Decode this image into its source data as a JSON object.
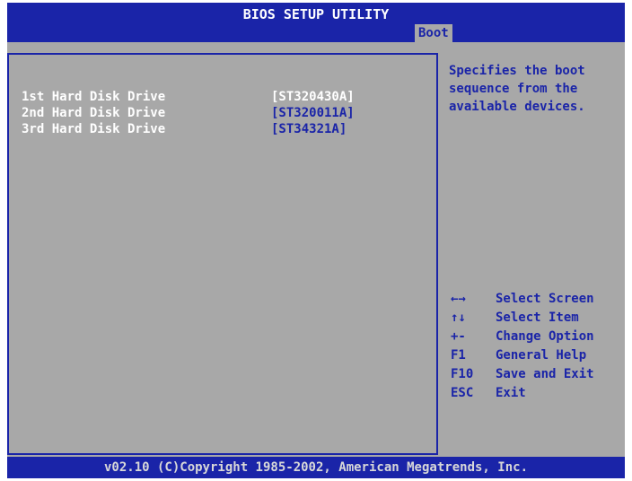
{
  "window": {
    "title": "BIOS SETUP UTILITY"
  },
  "tabs": [
    {
      "label": "Boot"
    }
  ],
  "main": {
    "items": [
      {
        "label": "1st Hard Disk Drive",
        "value": "[ST320430A]"
      },
      {
        "label": "2nd Hard Disk Drive",
        "value": "[ST320011A]"
      },
      {
        "label": "3rd Hard Disk Drive",
        "value": "[ST34321A]"
      }
    ]
  },
  "help": {
    "text": "Specifies the boot sequence from the available devices.",
    "keys": [
      {
        "key": "←→",
        "desc": "Select Screen",
        "icon": "left-right-arrows-icon"
      },
      {
        "key": "↑↓",
        "desc": "Select Item",
        "icon": "up-down-arrows-icon"
      },
      {
        "key": "+-",
        "desc": "Change Option",
        "icon": "plus-minus-icon"
      },
      {
        "key": "F1",
        "desc": "General Help"
      },
      {
        "key": "F10",
        "desc": "Save and Exit"
      },
      {
        "key": "ESC",
        "desc": "Exit"
      }
    ]
  },
  "footer": {
    "text": "v02.10 (C)Copyright 1985-2002, American Megatrends, Inc."
  },
  "colors": {
    "background": "#a8a8a8",
    "bar": "#1a24a8",
    "highlight": "#ffffff"
  }
}
